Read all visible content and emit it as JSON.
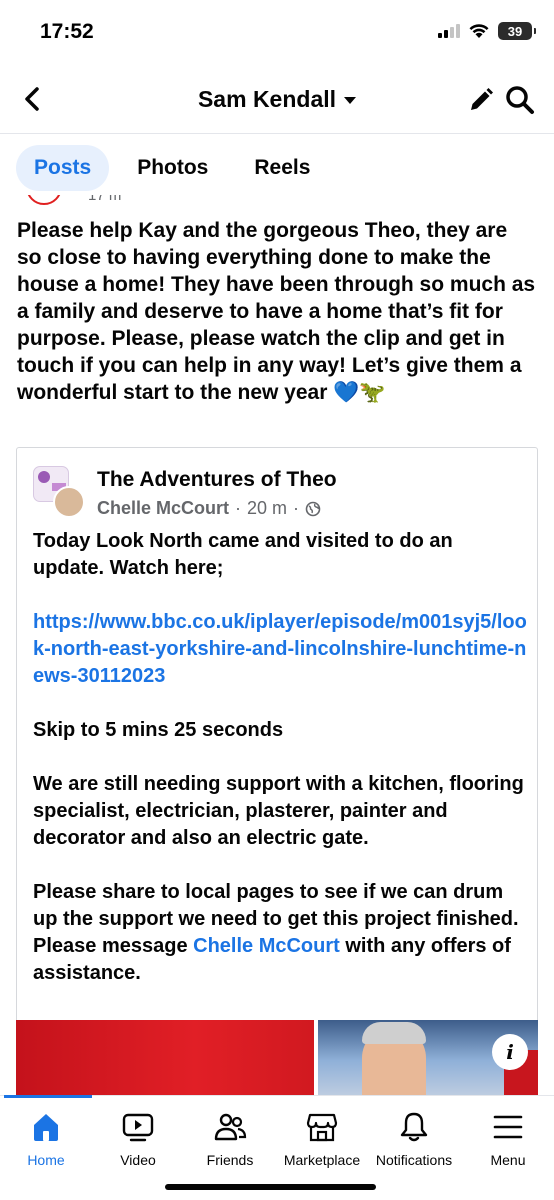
{
  "status_bar": {
    "time": "17:52",
    "battery": "39"
  },
  "header": {
    "title": "Sam Kendall"
  },
  "tabs": [
    {
      "label": "Posts",
      "active": true
    },
    {
      "label": "Photos",
      "active": false
    },
    {
      "label": "Reels",
      "active": false
    }
  ],
  "post": {
    "partial_meta": "17 m",
    "text": "Please help Kay and the gorgeous Theo, they are so close to having everything done to make the house a home! They have been through so much as a family and deserve to have a home that’s fit for purpose. Please, please watch the clip and get in touch if you can help in any way! Let’s give them a wonderful start to the new year 💙🦖"
  },
  "shared_post": {
    "page_name": "The Adventures of Theo",
    "author": "Chelle McCourt",
    "time": "20 m",
    "paragraph_1": "Today Look North came and visited to do an update.  Watch here;",
    "link": "https://www.bbc.co.uk/iplayer/episode/m001syj5/look-north-east-yorkshire-and-lincolnshire-lunchtime-news-30112023",
    "paragraph_3": "Skip to 5 mins 25 seconds",
    "paragraph_4": "We are still needing support with a kitchen, flooring specialist, electrician, plasterer, painter and decorator and also an electric gate.",
    "paragraph_5_before": "Please share to local pages to see if we can drum up the support we need to get this project finished. Please message ",
    "paragraph_5_mention": "Chelle McCourt",
    "paragraph_5_after": " with any offers of assistance.",
    "info_label": "i"
  },
  "bottom_nav": [
    {
      "label": "Home",
      "icon": "home-icon",
      "active": true
    },
    {
      "label": "Video",
      "icon": "video-icon",
      "active": false
    },
    {
      "label": "Friends",
      "icon": "friends-icon",
      "active": false
    },
    {
      "label": "Marketplace",
      "icon": "marketplace-icon",
      "active": false
    },
    {
      "label": "Notifications",
      "icon": "bell-icon",
      "active": false
    },
    {
      "label": "Menu",
      "icon": "menu-icon",
      "active": false
    }
  ],
  "colors": {
    "accent": "#1b74e4",
    "text": "#050505",
    "muted": "#65676b",
    "tab_active_bg": "#e7f0fd"
  }
}
